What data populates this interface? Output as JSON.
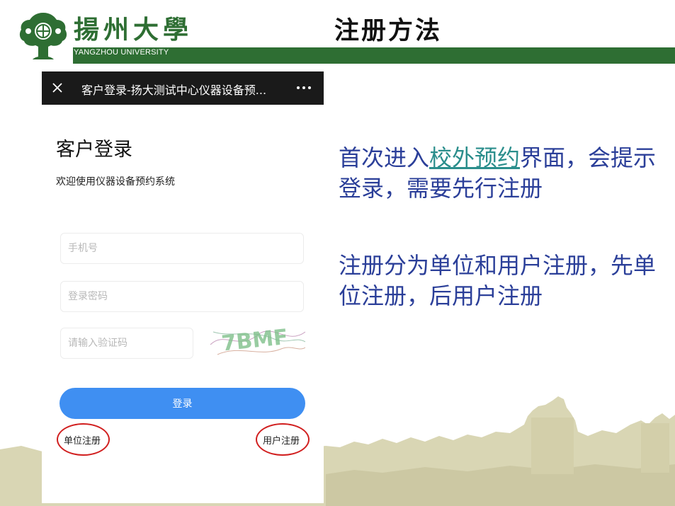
{
  "header": {
    "university_cn": "揚州大學",
    "university_en": "YANGZHOU UNIVERSITY",
    "slide_title": "注册方法"
  },
  "phone": {
    "topbar": {
      "close_icon": "close-icon",
      "title": "客户登录-扬大测试中心仪器设备预...",
      "more_icon": "more-dots-icon"
    },
    "login": {
      "heading": "客户登录",
      "subtitle": "欢迎使用仪器设备预约系统",
      "phone_placeholder": "手机号",
      "password_placeholder": "登录密码",
      "captcha_placeholder": "请输入验证码",
      "captcha_text": "7BMF",
      "login_button": "登录",
      "unit_register": "单位注册",
      "user_register": "用户注册"
    }
  },
  "notes": {
    "line1_prefix": "首次进入",
    "line1_link": "校外预约",
    "line1_suffix": "界面，会提示登录，需要先行注册",
    "line2": "注册分为单位和用户注册，先单位注册，后用户注册"
  },
  "colors": {
    "brand_green": "#2e6e33",
    "note_blue": "#2b3f99",
    "link_teal": "#2b8e8c",
    "button_blue": "#3f8ff2",
    "circle_red": "#d11f1f",
    "skyline": "#d9d6b4"
  }
}
